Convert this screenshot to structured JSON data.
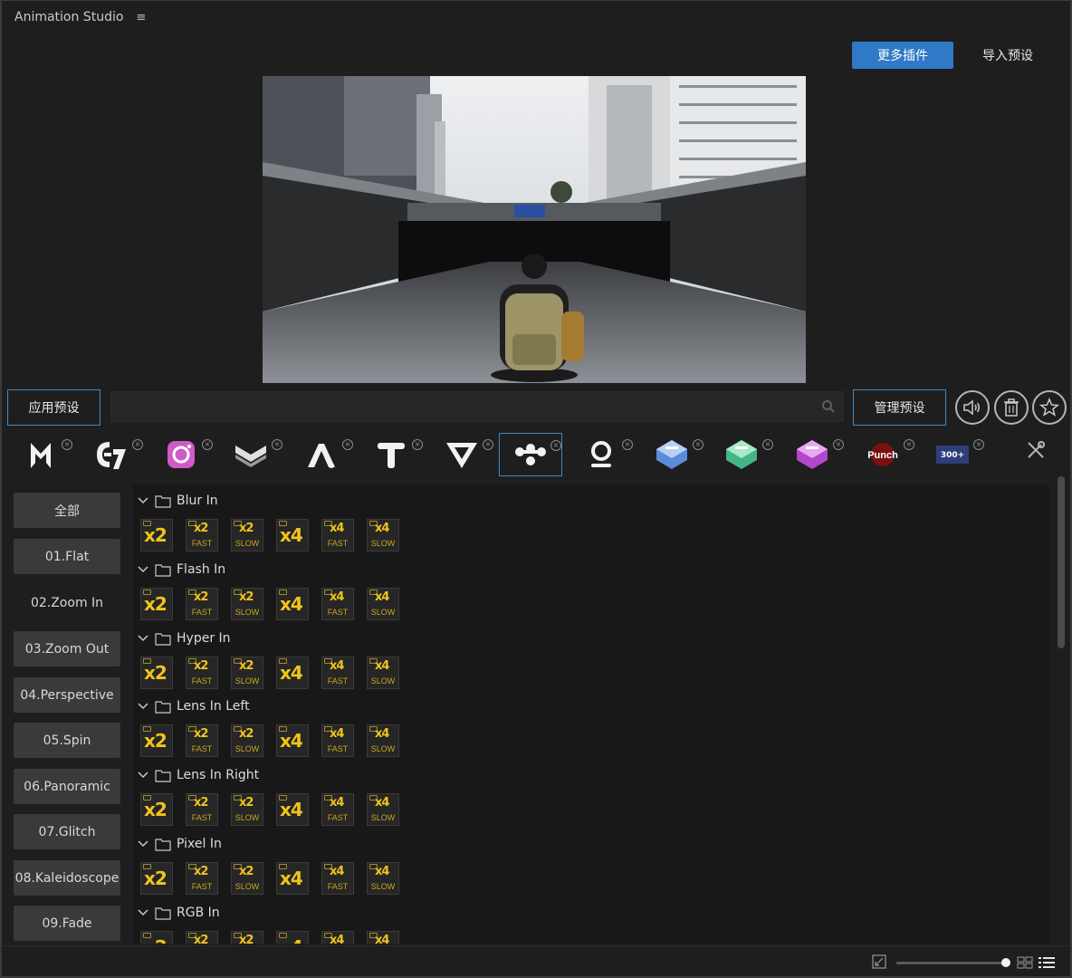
{
  "app": {
    "title": "Animation Studio",
    "menu_icon": "hamburger-icon"
  },
  "header": {
    "more_plugins_label": "更多插件",
    "import_presets_label": "导入预设"
  },
  "toolbar": {
    "apply_label": "应用预设",
    "search_placeholder": "",
    "manage_label": "管理预设"
  },
  "plugins": [
    {
      "name": "m-plugin"
    },
    {
      "name": "e7-plugin"
    },
    {
      "name": "camera-plugin"
    },
    {
      "name": "layers-plugin"
    },
    {
      "name": "a-plugin"
    },
    {
      "name": "t-plugin"
    },
    {
      "name": "v-plugin"
    },
    {
      "name": "transitions-plugin",
      "active": true
    },
    {
      "name": "o-plugin"
    },
    {
      "name": "e-blue-plugin"
    },
    {
      "name": "e-green-plugin"
    },
    {
      "name": "s-purple-plugin"
    },
    {
      "name": "punch-plugin",
      "label": "Punch"
    },
    {
      "name": "transitions-pack-plugin",
      "label": "300+"
    }
  ],
  "sidebar": {
    "items": [
      "全部",
      "01.Flat",
      "02.Zoom In",
      "03.Zoom Out",
      "04.Perspective",
      "05.Spin",
      "06.Panoramic",
      "07.Glitch",
      "08.Kaleidoscope",
      "09.Fade"
    ],
    "selected_index": 2
  },
  "groups": [
    {
      "label": "Blur In"
    },
    {
      "label": "Flash In"
    },
    {
      "label": "Hyper In"
    },
    {
      "label": "Lens In Left"
    },
    {
      "label": "Lens In Right"
    },
    {
      "label": "Pixel In"
    },
    {
      "label": "RGB In"
    }
  ],
  "tiles": [
    {
      "mult": "x2",
      "speed": ""
    },
    {
      "mult": "x2",
      "speed": "FAST"
    },
    {
      "mult": "x2",
      "speed": "SLOW"
    },
    {
      "mult": "x4",
      "speed": ""
    },
    {
      "mult": "x4",
      "speed": "FAST"
    },
    {
      "mult": "x4",
      "speed": "SLOW"
    }
  ],
  "colors": {
    "accent": "#2f79c6",
    "tile_gold": "#f0c419",
    "bg": "#1e1e1e"
  }
}
